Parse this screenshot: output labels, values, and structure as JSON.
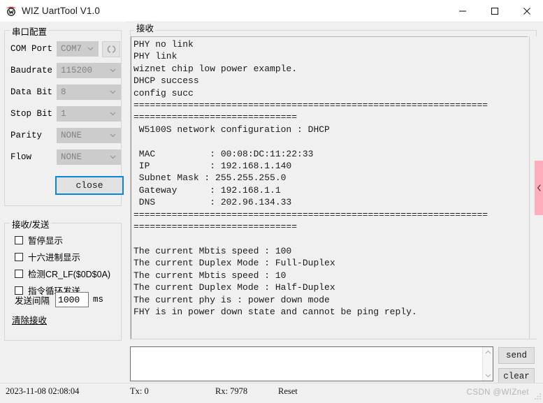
{
  "window": {
    "title": "WIZ UartTool V1.0",
    "icon": "wiznet-logo-icon",
    "minimize": "—",
    "maximize": "□",
    "close": "✕"
  },
  "serial_config": {
    "group_title": "串口配置",
    "fields": [
      {
        "label": "COM Port",
        "value": "COM7"
      },
      {
        "label": "Baudrate",
        "value": "115200"
      },
      {
        "label": "Data Bit",
        "value": "8"
      },
      {
        "label": "Stop Bit",
        "value": "1"
      },
      {
        "label": "Parity",
        "value": "NONE"
      },
      {
        "label": "Flow",
        "value": "NONE"
      }
    ],
    "refresh_icon": "refresh-icon",
    "close_button": "close"
  },
  "recv_send": {
    "group_title": "接收/发送",
    "checkboxes": [
      {
        "label": "暂停显示",
        "checked": false
      },
      {
        "label": "十六进制显示",
        "checked": false
      },
      {
        "label": "检测CR_LF($0D$0A)",
        "checked": false
      },
      {
        "label": "指令循环发送",
        "checked": false
      }
    ],
    "interval_label": "发送间隔",
    "interval_value": "1000",
    "interval_unit": "ms",
    "clear_link": "清除接收"
  },
  "receive": {
    "group_title": "接收",
    "terminal_text": "PHY no link\nPHY link\nwiznet chip low power example.\nDHCP success\nconfig succ\n=================================================================\n==============================\n W5100S network configuration : DHCP\n\n MAC          : 00:08:DC:11:22:33\n IP           : 192.168.1.140\n Subnet Mask : 255.255.255.0\n Gateway      : 192.168.1.1\n DNS          : 202.96.134.33\n=================================================================\n==============================\n\nThe current Mbtis speed : 100\nThe current Duplex Mode : Full-Duplex\nThe current Mbtis speed : 10\nThe current Duplex Mode : Half-Duplex\nThe current phy is : power down mode\nFHY is in power down state and cannot be ping reply."
  },
  "send_area": {
    "input_value": "",
    "input_placeholder": "",
    "send_label": "send",
    "clear_label": "clear"
  },
  "side_tab": {
    "icon": "chevron-left-icon",
    "color": "#ffadbd"
  },
  "statusbar": {
    "timestamp": "2023-11-08 02:08:04",
    "tx": "Tx: 0",
    "rx": "Rx: 7978",
    "reset": "Reset"
  },
  "watermark": "CSDN @WIZnet"
}
